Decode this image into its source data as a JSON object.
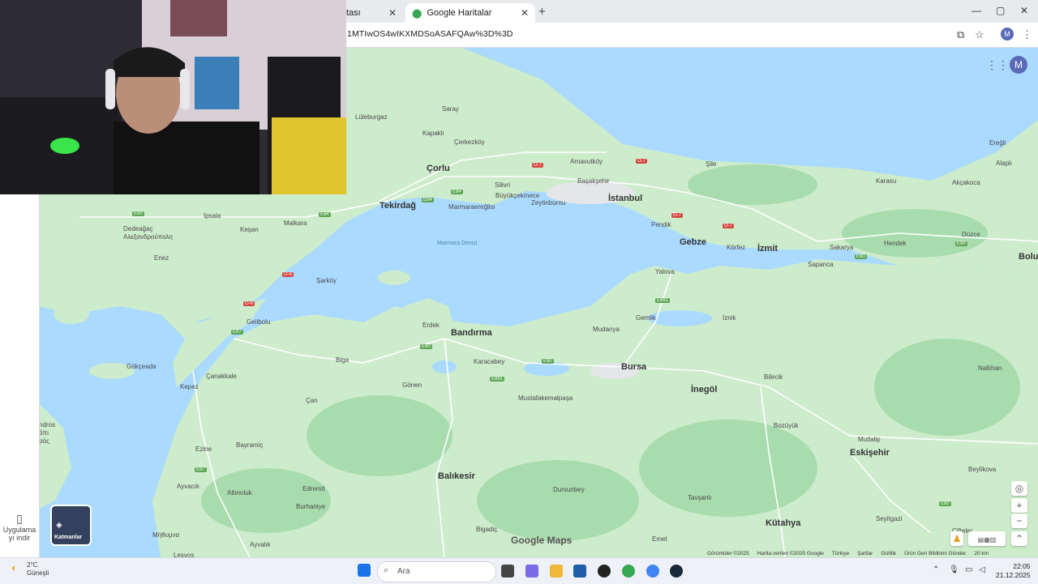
{
  "browser": {
    "tabs": [
      {
        "label": "tası"
      },
      {
        "label": "Google Haritalar"
      }
    ],
    "url": "1MTIwOS4wIKXMDSoASAFQAw%3D%3D",
    "window_controls": [
      "—",
      "▢",
      "✕"
    ]
  },
  "map": {
    "cities": [
      {
        "name": "İstanbul"
      },
      {
        "name": "Bursa"
      },
      {
        "name": "Bandırma"
      },
      {
        "name": "Tekirdağ"
      },
      {
        "name": "İzmit"
      },
      {
        "name": "Gebze"
      },
      {
        "name": "Balıkesir"
      },
      {
        "name": "Eskişehir"
      },
      {
        "name": "İnegöl"
      },
      {
        "name": "Kütahya"
      },
      {
        "name": "Çorlu"
      }
    ],
    "towns": [
      {
        "name": "Saray"
      },
      {
        "name": "Lüleburgaz"
      },
      {
        "name": "Kapaklı"
      },
      {
        "name": "Çerkezköy"
      },
      {
        "name": "Arnavutköy"
      },
      {
        "name": "Başakşehir"
      },
      {
        "name": "Silivri"
      },
      {
        "name": "Büyükçekmece"
      },
      {
        "name": "Zeytinburnu"
      },
      {
        "name": "Marmaraereğlisi"
      },
      {
        "name": "Pendik"
      },
      {
        "name": "Şile"
      },
      {
        "name": "Körfez"
      },
      {
        "name": "Sakarya"
      },
      {
        "name": "Sapanca"
      },
      {
        "name": "Hendek"
      },
      {
        "name": "Düzce"
      },
      {
        "name": "Karasu"
      },
      {
        "name": "Akçakoca"
      },
      {
        "name": "Ereğli"
      },
      {
        "name": "Alaplı"
      },
      {
        "name": "Bolu"
      },
      {
        "name": "İpsala"
      },
      {
        "name": "Keşan"
      },
      {
        "name": "Malkara"
      },
      {
        "name": "Dedeağaç"
      },
      {
        "name": "Αλεξανδρούπολη"
      },
      {
        "name": "Enez"
      },
      {
        "name": "Şarköy"
      },
      {
        "name": "Gelibolu"
      },
      {
        "name": "Yalova"
      },
      {
        "name": "Erdek"
      },
      {
        "name": "Mudanya"
      },
      {
        "name": "Gemlik"
      },
      {
        "name": "İznik"
      },
      {
        "name": "Karacabey"
      },
      {
        "name": "Bilecik"
      },
      {
        "name": "Nallıhan"
      },
      {
        "name": "Biga"
      },
      {
        "name": "Çanakkale"
      },
      {
        "name": "Kepez"
      },
      {
        "name": "Gökçeada"
      },
      {
        "name": "Gönen"
      },
      {
        "name": "Çan"
      },
      {
        "name": "Mustafakemalpaşa"
      },
      {
        "name": "Bozüyük"
      },
      {
        "name": "Ezine"
      },
      {
        "name": "Bayramiç"
      },
      {
        "name": "Mutlalip"
      },
      {
        "name": "Beylikova"
      },
      {
        "name": "Ayvacık"
      },
      {
        "name": "Altınoluk"
      },
      {
        "name": "Edremit"
      },
      {
        "name": "Burhaniye"
      },
      {
        "name": "Dursunbey"
      },
      {
        "name": "Tavşanlı"
      },
      {
        "name": "Seyitgazi"
      },
      {
        "name": "Çifteler"
      },
      {
        "name": "Bigadiç"
      },
      {
        "name": "Emet"
      },
      {
        "name": "Ayvalık"
      },
      {
        "name": "Lesvos"
      },
      {
        "name": "Μήθυμνα"
      },
      {
        "name": "ndros"
      },
      {
        "name": "άπι"
      },
      {
        "name": "ρός"
      }
    ],
    "sea_labels": [
      {
        "name": "Marmara Denizi"
      }
    ],
    "road_shields": [
      "E90",
      "E84",
      "E84",
      "E84",
      "O-7",
      "O-7",
      "O-7",
      "O-7",
      "O-6",
      "O-6",
      "E87",
      "E90",
      "E881",
      "E881",
      "E90",
      "E87",
      "E90",
      "E90",
      "E80"
    ],
    "logo": "Google Maps",
    "attribution": [
      "Görüntüler ©2025",
      "Harita verileri ©2025 Google",
      "Türkiye",
      "Şartlar",
      "Gizlilik",
      "Ürün Geri Bildirimi Gönder",
      "20 km"
    ],
    "layers_label": "Katmanlar",
    "app_download": "Uygulama yı indir",
    "avatar_letter": "M"
  },
  "taskbar": {
    "weather_temp": "2°C",
    "weather_desc": "Güneşli",
    "search_placeholder": "Ara",
    "time": "22:05",
    "date": "21.12.2025"
  },
  "colors": {
    "water": "#aadaff",
    "land": "#cdeccb",
    "green": "#a8dcae",
    "road": "#ffffff",
    "accent": "#5a6ab8"
  }
}
